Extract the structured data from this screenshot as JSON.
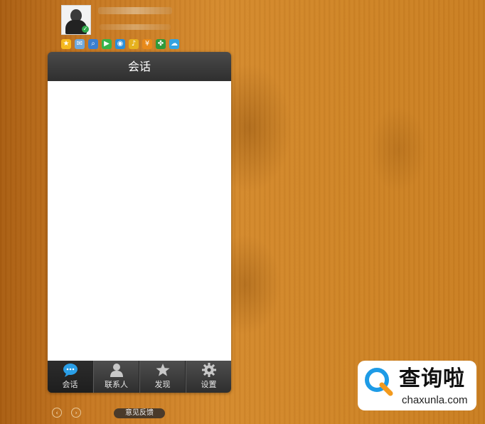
{
  "panel": {
    "title": "会话"
  },
  "tabs": [
    {
      "label": "会话",
      "icon": "chat-bubble-icon",
      "active": true
    },
    {
      "label": "联系人",
      "icon": "person-icon",
      "active": false
    },
    {
      "label": "发现",
      "icon": "star-icon",
      "active": false
    },
    {
      "label": "设置",
      "icon": "gear-icon",
      "active": false
    }
  ],
  "footer": {
    "back_icon": "chevron-left-icon",
    "forward_icon": "chevron-right-icon",
    "feedback_label": "意见反馈"
  },
  "app_icons": [
    "favorite-star-icon",
    "mail-icon",
    "search-icon",
    "game-icon",
    "browser-icon",
    "music-icon",
    "wallet-icon",
    "clover-icon",
    "cloud-icon"
  ],
  "watermark": {
    "title": "查询啦",
    "url": "chaxunla.com"
  },
  "colors": {
    "accent_blue": "#1e9be6",
    "logo_orange": "#f39a1e"
  }
}
